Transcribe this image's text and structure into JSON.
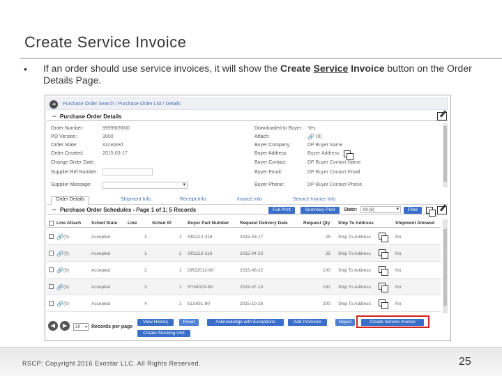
{
  "slide": {
    "title": "Create Service Invoice",
    "bullet_mark": "•",
    "bullet_part1": "If an order should use service invoices, it will show the ",
    "bullet_bold1": "Create ",
    "bullet_underline": "Service",
    "bullet_bold2": " Invoice",
    "bullet_part2": " button on the Order Details Page.",
    "footer": "RSCP: Copyright 2016 Exostar LLC. All Rights Reserved.",
    "page_number": "25"
  },
  "breadcrumb": {
    "text": "Purchase Order Search / Purchase Order List / Details"
  },
  "po_details": {
    "title": "Purchase Order Details",
    "left_fields": [
      {
        "label": "Order Number:",
        "value": "9999905600"
      },
      {
        "label": "PO Version:",
        "value": "3000"
      },
      {
        "label": "Order State:",
        "value": "Accepted"
      },
      {
        "label": "Order Created:",
        "value": "2015-03-17"
      },
      {
        "label": "Change Order Date:",
        "value": ""
      },
      {
        "label": "Supplier Ref Number:",
        "value": ""
      },
      {
        "label": "Supplier Message:",
        "value": ""
      }
    ],
    "right_fields": [
      {
        "label": "Downloaded to Buyer:",
        "value": "Yes"
      },
      {
        "label": "Attach:",
        "value": "(0)"
      },
      {
        "label": "Buyer Company:",
        "value": "DP Buyer Name"
      },
      {
        "label": "Buyer Address:",
        "value": "Buyer Address"
      },
      {
        "label": "Buyer Contact:",
        "value": "DP Buyer Contact Name"
      },
      {
        "label": "Buyer Email:",
        "value": "DP Buyer Contact Email"
      },
      {
        "label": "Buyer Phone:",
        "value": "DP Buyer Contact Phone"
      }
    ]
  },
  "tabs": [
    {
      "label": "Order Details"
    },
    {
      "label": "Shipment Info"
    },
    {
      "label": "Receipt Info"
    },
    {
      "label": "Invoice Info"
    },
    {
      "label": "Service Invoice Info"
    }
  ],
  "schedules": {
    "title": "Purchase Order Schedules - Page 1 of 1; 5 Records",
    "full_print": "Full Print",
    "summary_print": "Summary Print",
    "state_label": "State:",
    "state_value": "All (6)",
    "filter": "Filter",
    "columns": [
      "Line Attach",
      "Sched State",
      "Line",
      "Sched ID",
      "Buyer Part Number",
      "Request Delivery Date",
      "Request Qty",
      "Ship To Address",
      "Shipment Allowed"
    ],
    "rows": [
      {
        "attach": "(0)",
        "state": "Accepted",
        "line": "1",
        "sched": "1",
        "part": "SR1112-316",
        "date": "2015-03-17",
        "qty": "25",
        "ship": "Ship To Address",
        "allowed": "No"
      },
      {
        "attach": "(0)",
        "state": "Accepted",
        "line": "1",
        "sched": "2",
        "part": "SR1112-316",
        "date": "2015-04-23",
        "qty": "25",
        "ship": "Ship To Address",
        "allowed": "No"
      },
      {
        "attach": "(0)",
        "state": "Accepted",
        "line": "2",
        "sched": "1",
        "part": "GR22012-80",
        "date": "2015-06-22",
        "qty": "100",
        "ship": "Ship To Address",
        "allowed": "No"
      },
      {
        "attach": "(0)",
        "state": "Accepted",
        "line": "3",
        "sched": "1",
        "part": "SY04023-93",
        "date": "2015-07-13",
        "qty": "150",
        "ship": "Ship To Address",
        "allowed": "No"
      },
      {
        "attach": "(0)",
        "state": "Accepted",
        "line": "4",
        "sched": "1",
        "part": "EL5031-90",
        "date": "2015-10-26",
        "qty": "200",
        "ship": "Ship To Address",
        "allowed": "No"
      }
    ]
  },
  "pager": {
    "per_page": "20",
    "per_page_label": "Records per page"
  },
  "actions": {
    "view_history": "View History",
    "reset": "Reset",
    "acknowledge": "Acknowledge with Exceptions",
    "add_promises": "Add Promises",
    "reject": "Reject",
    "create_service_invoice": "Create Service Invoice",
    "create_stocking_unit": "Create Stocking Unit"
  }
}
